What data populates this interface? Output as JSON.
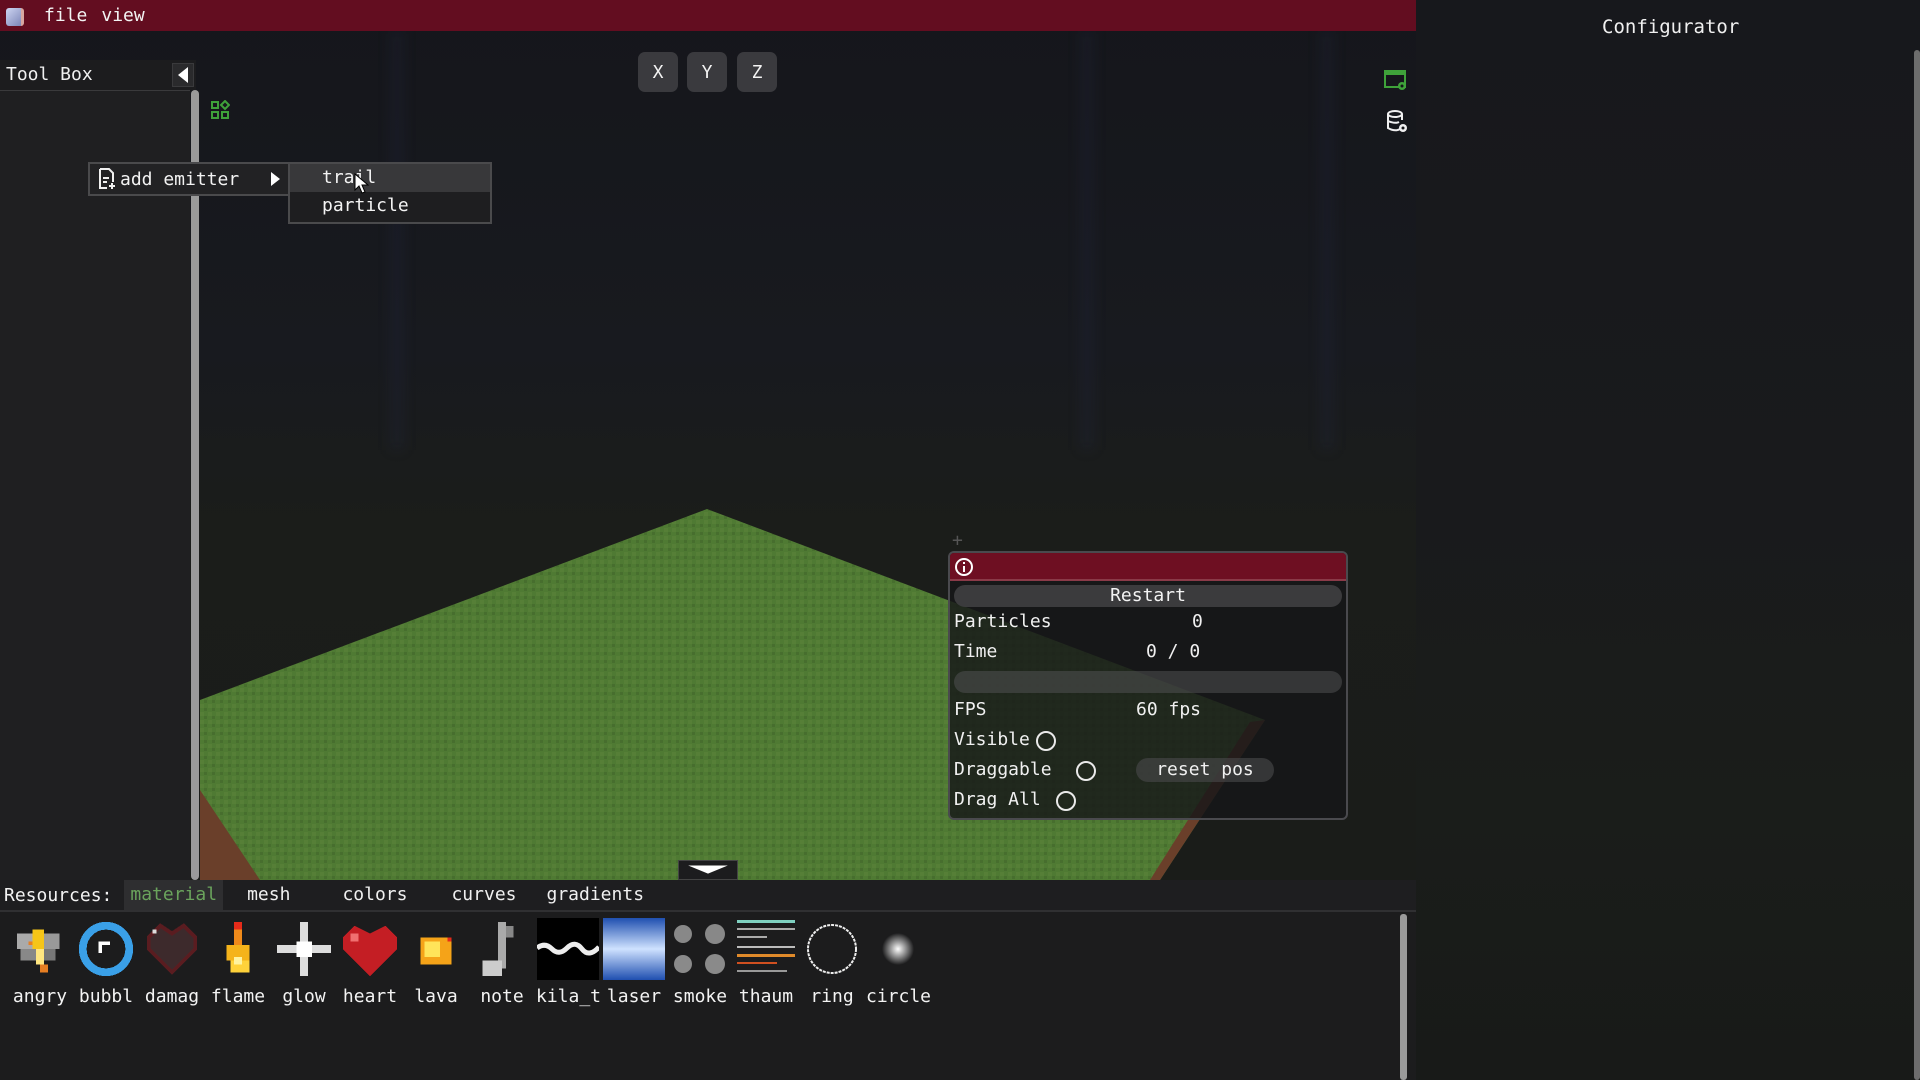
{
  "menubar": {
    "items": [
      "file",
      "view"
    ]
  },
  "toolbox": {
    "title": "Tool Box"
  },
  "context_menu": {
    "item_label": "add emitter",
    "submenu": [
      {
        "label": "trail",
        "hovered": true
      },
      {
        "label": "particle",
        "hovered": false
      }
    ]
  },
  "axis_buttons": [
    "X",
    "Y",
    "Z"
  ],
  "configurator": {
    "title": "Configurator"
  },
  "stats_panel": {
    "restart_label": "Restart",
    "particles_label": "Particles",
    "particles_value": "0",
    "time_label": "Time",
    "time_value": "0 / 0",
    "time_progress": 0,
    "fps_label": "FPS",
    "fps_value": "60 fps",
    "visible_label": "Visible",
    "visible_checked": false,
    "draggable_label": "Draggable",
    "draggable_checked": false,
    "reset_pos_label": "reset pos",
    "drag_all_label": "Drag All",
    "drag_all_checked": false
  },
  "resources": {
    "label": "Resources:",
    "tabs": [
      {
        "label": "material",
        "active": true
      },
      {
        "label": "mesh",
        "active": false
      },
      {
        "label": "colors",
        "active": false
      },
      {
        "label": "curves",
        "active": false
      },
      {
        "label": "gradients",
        "active": false
      }
    ],
    "items": [
      {
        "name": "angry",
        "icon": "angry-particle-icon"
      },
      {
        "name": "bubbl",
        "icon": "bubble-particle-icon"
      },
      {
        "name": "damag",
        "icon": "damage-heart-icon"
      },
      {
        "name": "flame",
        "icon": "flame-icon"
      },
      {
        "name": "glow",
        "icon": "glow-sparkle-icon"
      },
      {
        "name": "heart",
        "icon": "heart-icon"
      },
      {
        "name": "lava",
        "icon": "lava-icon"
      },
      {
        "name": "note",
        "icon": "music-note-icon"
      },
      {
        "name": "kila_t",
        "icon": "kila-trail-icon"
      },
      {
        "name": "laser",
        "icon": "laser-icon"
      },
      {
        "name": "smoke",
        "icon": "smoke-icon"
      },
      {
        "name": "thaum",
        "icon": "thaum-icon"
      },
      {
        "name": "ring",
        "icon": "ring-icon"
      },
      {
        "name": "circle",
        "icon": "circle-glow-icon"
      }
    ]
  },
  "colors": {
    "menubar_bg": "#630d20",
    "accent_green": "#6aa35c",
    "panel_header": "#6e0f22"
  }
}
